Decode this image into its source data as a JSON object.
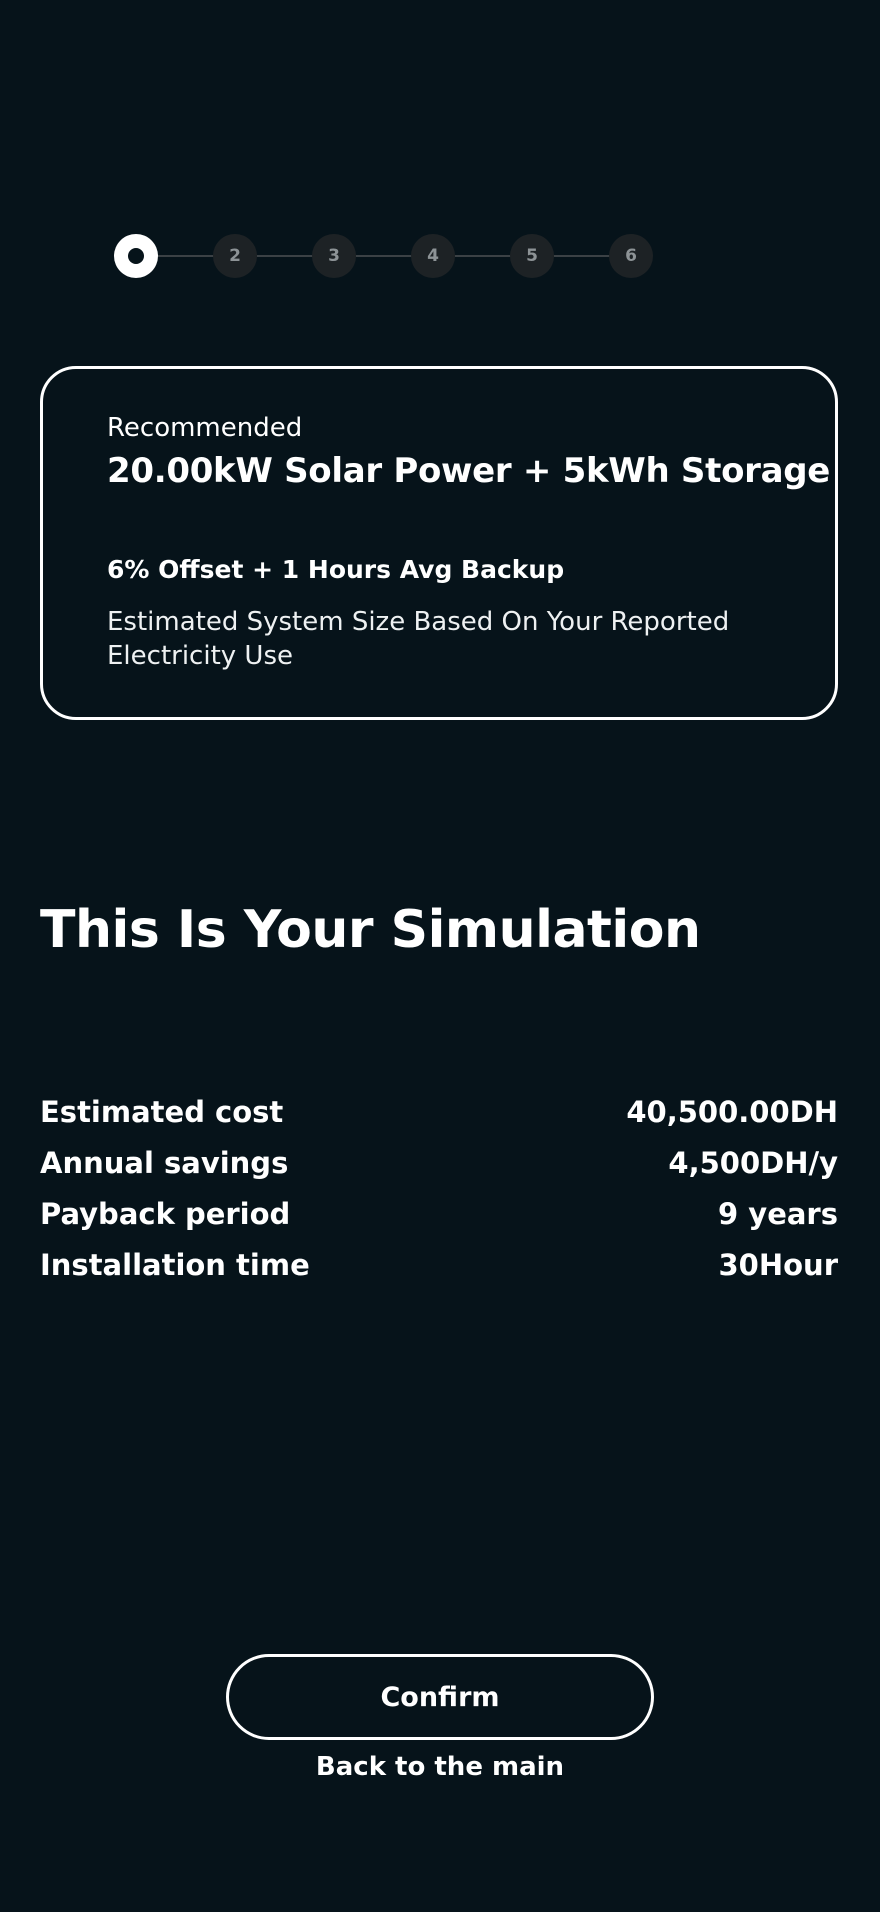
{
  "stepper": {
    "current": 1,
    "steps": [
      "1",
      "2",
      "3",
      "4",
      "5",
      "6"
    ]
  },
  "recommendation": {
    "label": "Recommended",
    "title": "20.00kW Solar Power + 5kWh Storage",
    "offset": "6% Offset + 1 Hours Avg Backup",
    "description": "Estimated System Size Based On Your Reported Electricity Use"
  },
  "simulation": {
    "heading": "This Is Your Simulation",
    "stats": [
      {
        "label": "Estimated cost",
        "value": "40,500.00DH"
      },
      {
        "label": "Annual savings",
        "value": "4,500DH/y"
      },
      {
        "label": "Payback period",
        "value": "9 years"
      },
      {
        "label": "Installation time",
        "value": "30Hour"
      }
    ]
  },
  "actions": {
    "confirm_label": "Confirm",
    "back_label": "Back to the main"
  },
  "colors": {
    "background": "#06131a",
    "foreground": "#ffffff",
    "step_inactive": "#1d2225",
    "connector": "#3b4145"
  }
}
